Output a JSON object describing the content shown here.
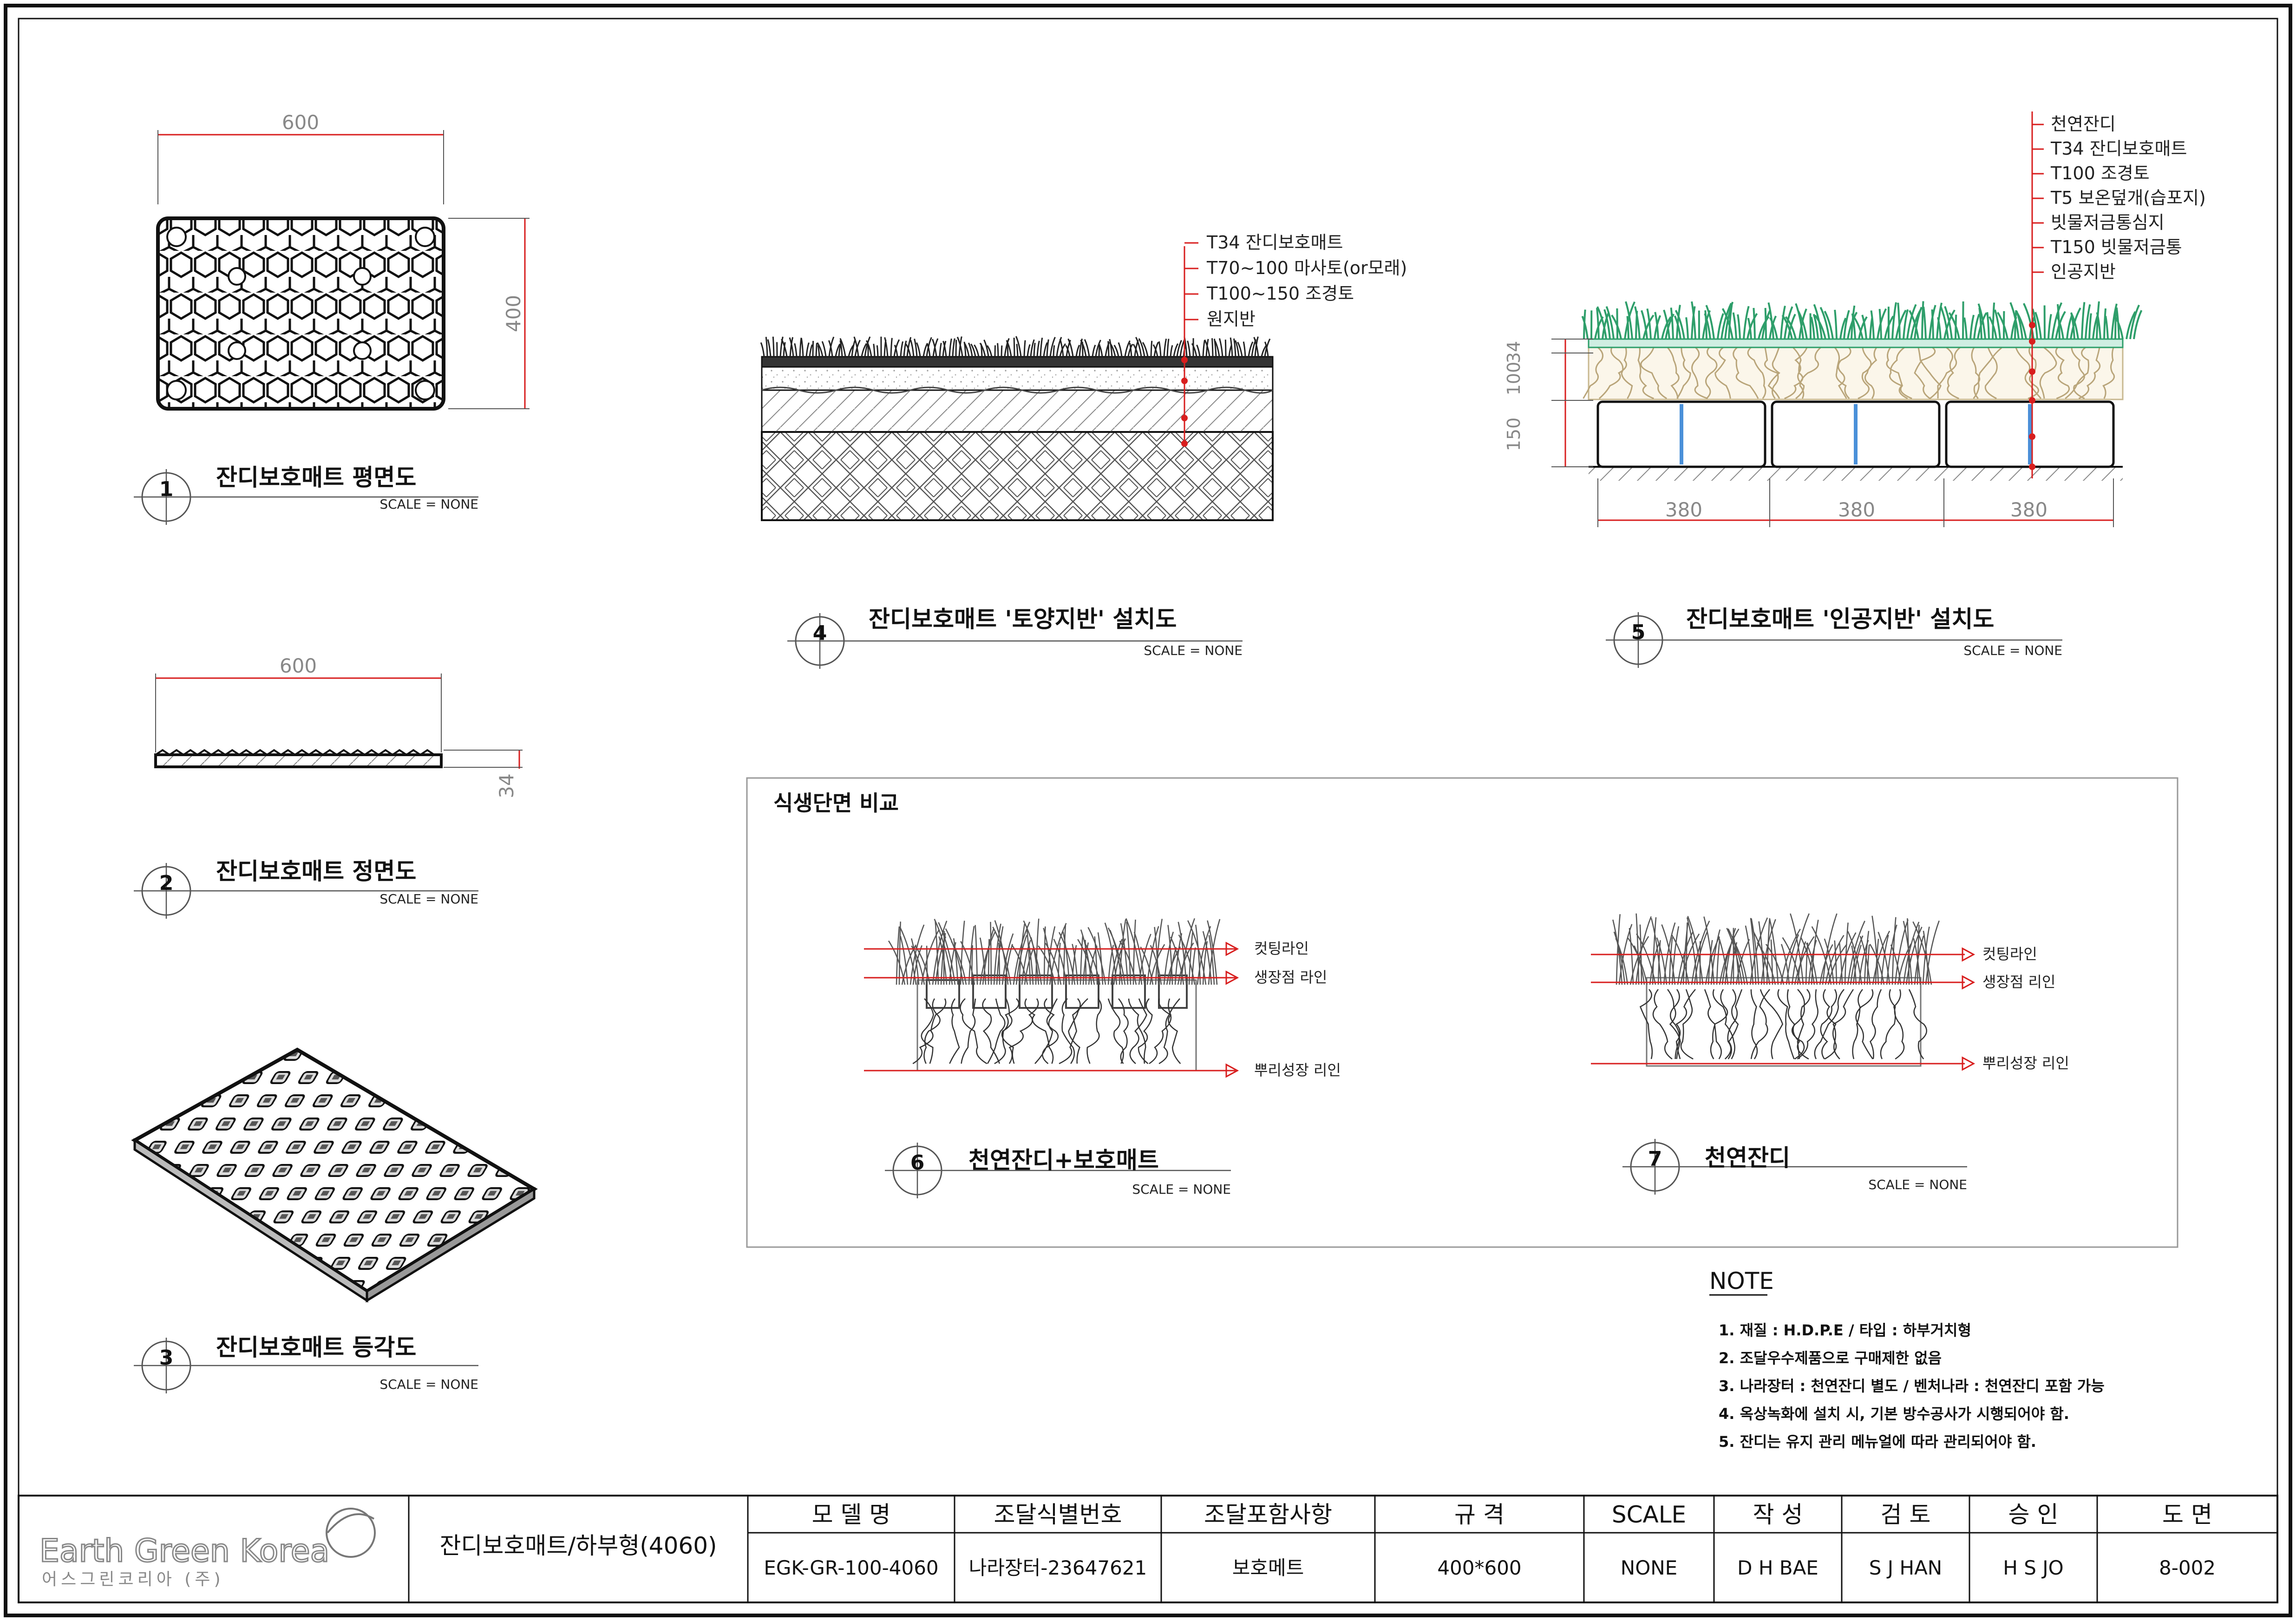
{
  "dims": {
    "plan_width": "600",
    "plan_height": "400",
    "front_width": "600",
    "front_height": "34",
    "ground_d1": "34",
    "ground_d2": "100",
    "ground_d3": "150",
    "ground_w1": "380",
    "ground_w2": "380",
    "ground_w3": "380"
  },
  "views": [
    {
      "num": "1",
      "title": "잔디보호매트 평면도",
      "scale": "SCALE = NONE"
    },
    {
      "num": "2",
      "title": "잔디보호매트 정면도",
      "scale": "SCALE = NONE"
    },
    {
      "num": "3",
      "title": "잔디보호매트 등각도",
      "scale": "SCALE = NONE"
    },
    {
      "num": "4",
      "title": "잔디보호매트 '토양지반' 설치도",
      "scale": "SCALE = NONE"
    },
    {
      "num": "5",
      "title": "잔디보호매트 '인공지반' 설치도",
      "scale": "SCALE = NONE"
    },
    {
      "num": "6",
      "title": "천연잔디+보호매트",
      "scale": "SCALE = NONE"
    },
    {
      "num": "7",
      "title": "천연잔디",
      "scale": "SCALE = NONE"
    }
  ],
  "soil_labels": [
    "T34 잔디보호매트",
    "T70~100 마사토(or모래)",
    "T100~150 조경토",
    "원지반"
  ],
  "artificial_labels": [
    "천연잔디",
    "T34 잔디보호매트",
    "T100 조경토",
    "T5 보온덮개(습포지)",
    "빗물저금통심지",
    "T150 빗물저금통",
    "인공지반"
  ],
  "compare": {
    "title": "식생단면 비교",
    "mat_lines": [
      "컷팅라인",
      "생장점 라인",
      "뿌리성장 리인"
    ],
    "natural_lines": [
      "컷팅라인",
      "생장점 리인",
      "뿌리성장 리인"
    ]
  },
  "note": {
    "title": "NOTE",
    "items": [
      "1. 재질 : H.D.P.E / 타입 : 하부거치형",
      "2. 조달우수제품으로 구매제한 없음",
      "3. 나라장터 : 천연잔디 별도 / 벤처나라 : 천연잔디 포함 가능",
      "4. 옥상녹화에 설치 시, 기본 방수공사가 시행되어야 함.",
      "5. 잔디는 유지 관리 메뉴얼에 따라 관리되어야 함."
    ]
  },
  "titleblock": {
    "logo_main": "Earth Green Korea",
    "logo_sub": "어스그린코리아 (주)",
    "product": "잔디보호매트/하부형(4060)",
    "headers": [
      "모 델 명",
      "조달식별번호",
      "조달포함사항",
      "규  격",
      "SCALE",
      "작 성",
      "검 토",
      "승 인",
      "도 면"
    ],
    "values": [
      "EGK-GR-100-4060",
      "나라장터-23647621",
      "보호메트",
      "400*600",
      "NONE",
      "D H BAE",
      "S J HAN",
      "H S JO",
      "8-002"
    ]
  },
  "colors": {
    "dim_red": "#d81e1e",
    "grass_green": "#2e9e6a",
    "water_blue": "#4a90d9"
  }
}
